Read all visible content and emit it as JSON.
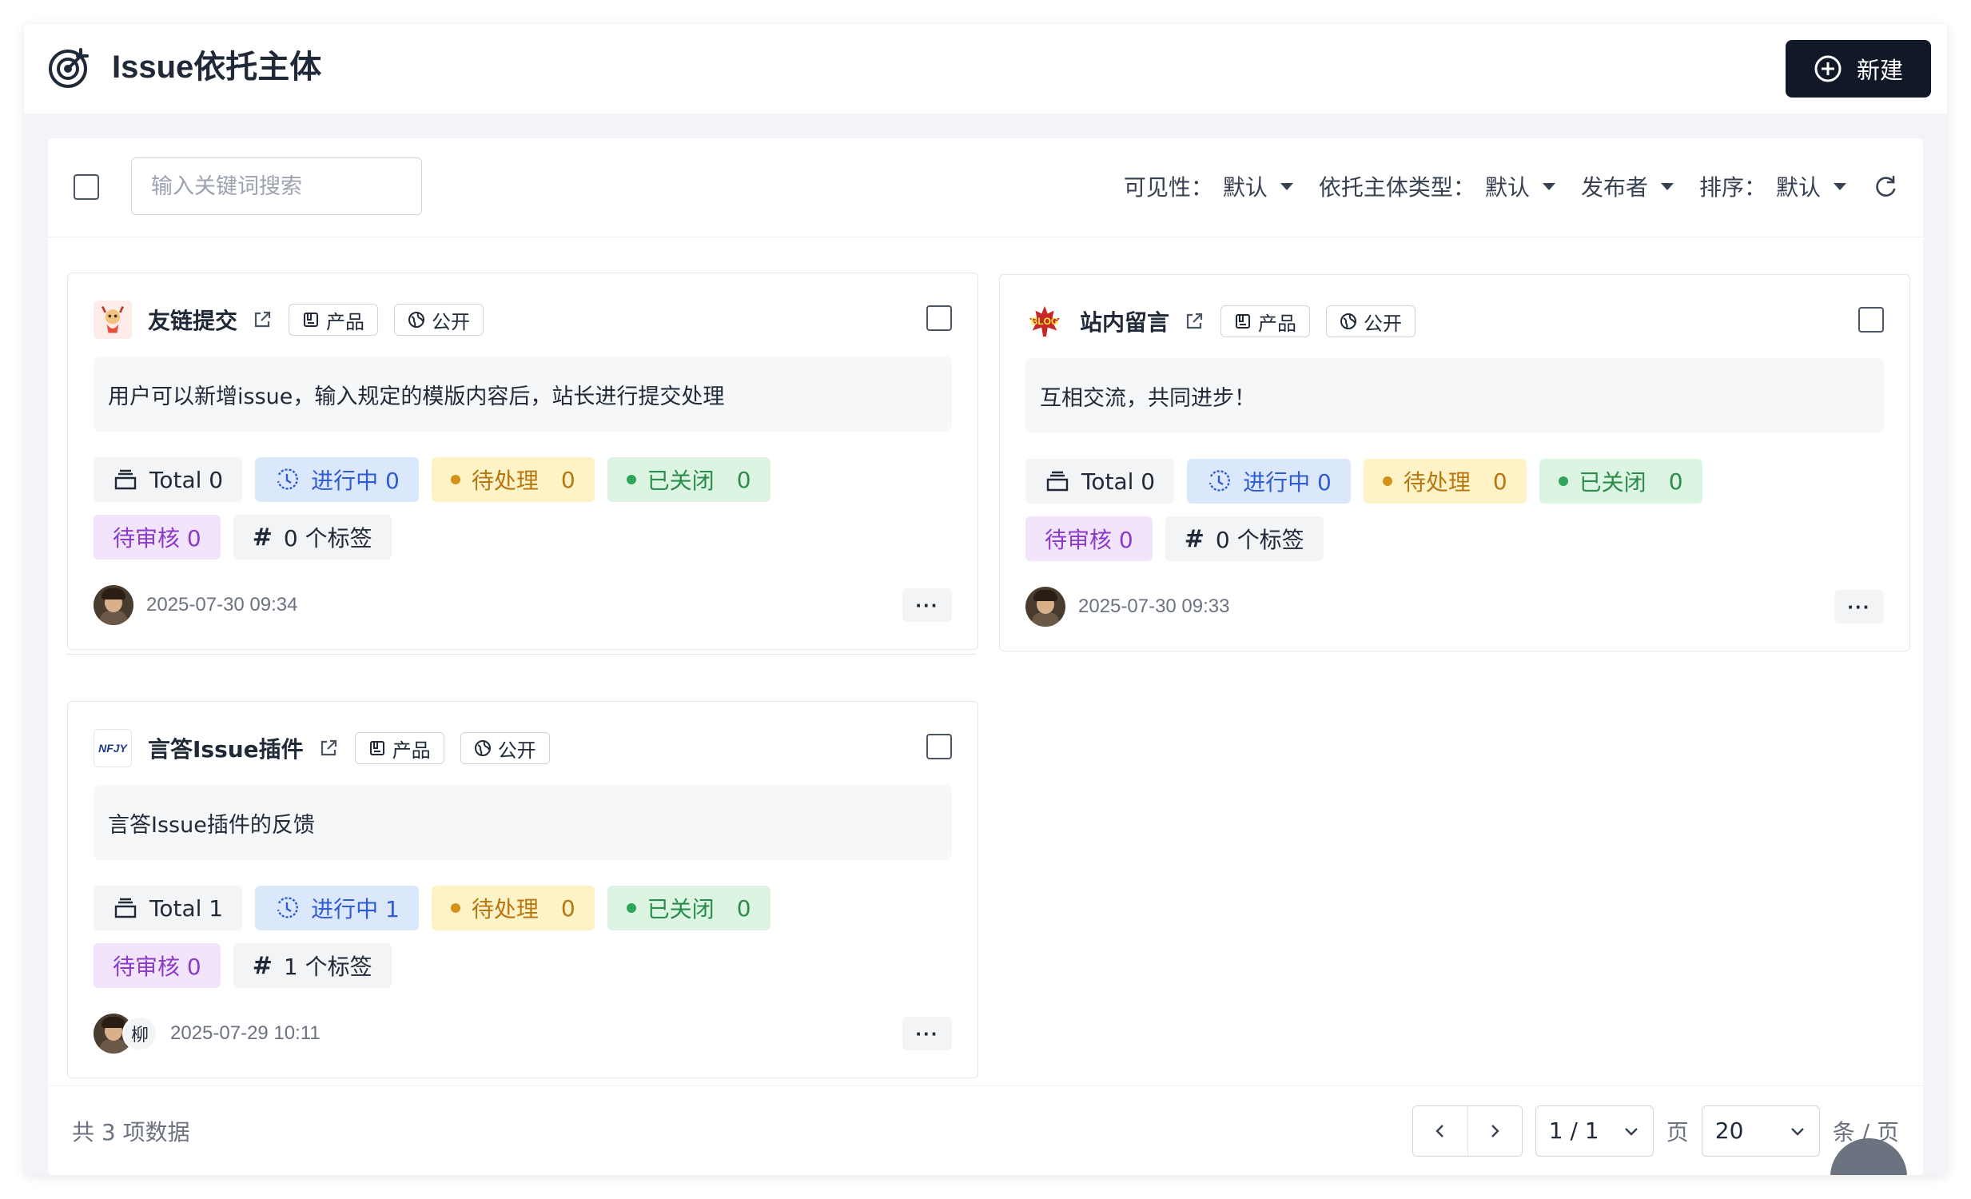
{
  "header": {
    "title": "Issue依托主体",
    "new_label": "新建"
  },
  "toolbar": {
    "search_placeholder": "输入关键词搜索",
    "filters": [
      {
        "label": "可见性：",
        "value": "默认"
      },
      {
        "label": "依托主体类型：",
        "value": "默认"
      },
      {
        "label": "发布者",
        "value": ""
      },
      {
        "label": "排序：",
        "value": "默认"
      }
    ]
  },
  "cards": [
    {
      "title": "友链提交",
      "type_label": "产品",
      "visibility_label": "公开",
      "description": "用户可以新增issue，输入规定的模版内容后，站长进行提交处理",
      "stats": {
        "total": "Total 0",
        "in_progress": "进行中 0",
        "pending_label": "待处理",
        "pending_count": "0",
        "closed_label": "已关闭",
        "closed_count": "0",
        "review": "待审核 0",
        "tags": "0 个标签"
      },
      "date": "2025-07-30 09:34"
    },
    {
      "title": "站内留言",
      "logo_text": "BLOG",
      "type_label": "产品",
      "visibility_label": "公开",
      "description": "互相交流，共同进步！",
      "stats": {
        "total": "Total 0",
        "in_progress": "进行中 0",
        "pending_label": "待处理",
        "pending_count": "0",
        "closed_label": "已关闭",
        "closed_count": "0",
        "review": "待审核 0",
        "tags": "0 个标签"
      },
      "date": "2025-07-30 09:33"
    },
    {
      "title": "言答Issue插件",
      "logo_text": "NFJY",
      "type_label": "产品",
      "visibility_label": "公开",
      "description": "言答Issue插件的反馈",
      "stats": {
        "total": "Total 1",
        "in_progress": "进行中 1",
        "pending_label": "待处理",
        "pending_count": "0",
        "closed_label": "已关闭",
        "closed_count": "0",
        "review": "待审核 0",
        "tags": "1 个标签"
      },
      "second_user": "柳",
      "date": "2025-07-29 10:11"
    }
  ],
  "more_label": "···",
  "footer": {
    "total": "共 3 项数据",
    "page_value": "1 / 1",
    "page_unit": "页",
    "size_value": "20",
    "size_unit": "条 / 页"
  },
  "colors": {
    "primary": "#111827",
    "in_progress": "#2f5bd3",
    "pending": "#b77610",
    "closed": "#2e8b4e",
    "review": "#8a3cc9"
  },
  "icons": [
    "target-icon",
    "plus-circle-icon",
    "refresh-icon",
    "external-link-icon",
    "product-icon",
    "globe-icon",
    "inbox-icon",
    "clock-icon",
    "chevron-left-icon",
    "chevron-right-icon",
    "chevron-down-icon"
  ]
}
